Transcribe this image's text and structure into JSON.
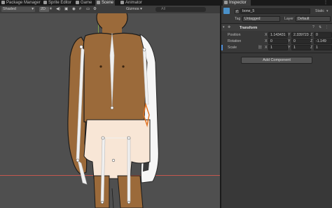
{
  "tabs": {
    "package_manager": "Package Manager",
    "sprite_editor": "Sprite Editor",
    "game": "Game",
    "scene": "Scene",
    "animator": "Animator",
    "inspector": "Inspector"
  },
  "toolbar": {
    "shading_mode": "Shaded",
    "mode_2d": "2D",
    "gizmos": "Gizmos",
    "search_placeholder": "All"
  },
  "inspector": {
    "object_name": "bone_5",
    "static_label": "Static",
    "tag_label": "Tag",
    "tag_value": "Untagged",
    "layer_label": "Layer",
    "layer_value": "Default",
    "component_title": "Transform",
    "position_label": "Position",
    "rotation_label": "Rotation",
    "scale_label": "Scale",
    "position": {
      "x": "1.143431",
      "y": "2.339723",
      "z": "0"
    },
    "rotation": {
      "x": "0",
      "y": "0",
      "z": "-1.149"
    },
    "scale": {
      "x": "1",
      "y": "1",
      "z": "1"
    },
    "add_component": "Add Component"
  },
  "axis_letters": {
    "x": "X",
    "y": "Y",
    "z": "Z"
  },
  "colors": {
    "skin": "#9b6a3a",
    "shorts": "#f8e6d6",
    "bone": "#f0f0f0",
    "selected_bone": "#e0701e",
    "scene_bg": "#4f4f4f"
  }
}
